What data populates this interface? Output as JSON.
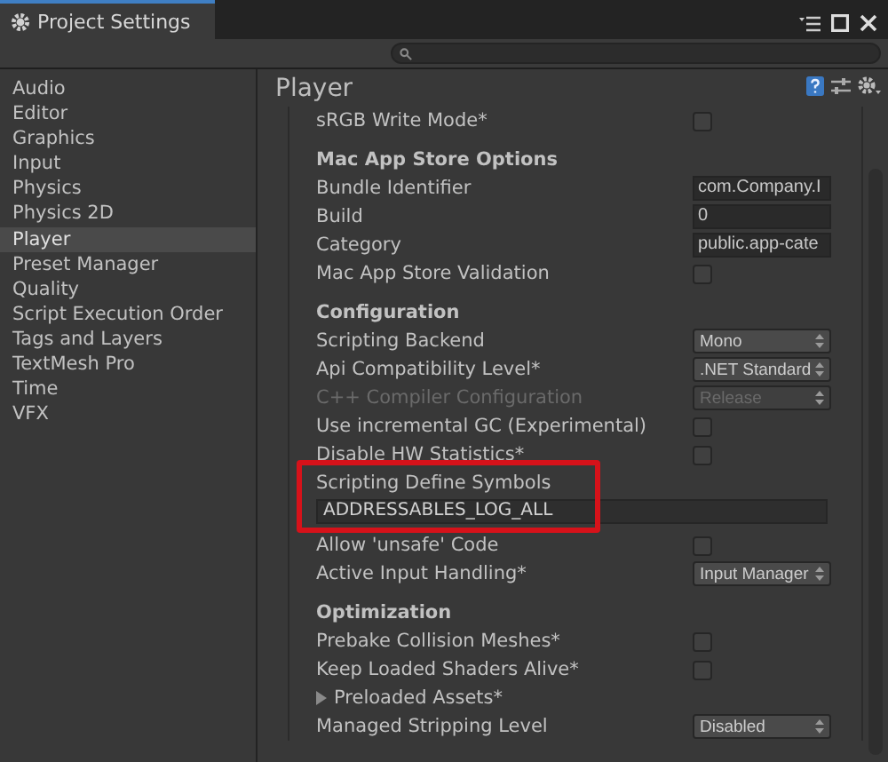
{
  "window": {
    "title": "Project Settings"
  },
  "sidebar": {
    "items": [
      {
        "label": "Audio",
        "selected": false
      },
      {
        "label": "Editor",
        "selected": false
      },
      {
        "label": "Graphics",
        "selected": false
      },
      {
        "label": "Input",
        "selected": false
      },
      {
        "label": "Physics",
        "selected": false
      },
      {
        "label": "Physics 2D",
        "selected": false
      },
      {
        "label": "Player",
        "selected": true
      },
      {
        "label": "Preset Manager",
        "selected": false
      },
      {
        "label": "Quality",
        "selected": false
      },
      {
        "label": "Script Execution Order",
        "selected": false
      },
      {
        "label": "Tags and Layers",
        "selected": false
      },
      {
        "label": "TextMesh Pro",
        "selected": false
      },
      {
        "label": "Time",
        "selected": false
      },
      {
        "label": "VFX",
        "selected": false
      }
    ]
  },
  "panel": {
    "title": "Player",
    "rows": [
      {
        "kind": "checkbox",
        "label": "sRGB Write Mode*",
        "checked": false,
        "disabled": false
      },
      {
        "kind": "header",
        "label": "Mac App Store Options"
      },
      {
        "kind": "text",
        "label": "Bundle Identifier",
        "value": "com.Company.I"
      },
      {
        "kind": "text",
        "label": "Build",
        "value": "0"
      },
      {
        "kind": "text",
        "label": "Category",
        "value": "public.app-cate"
      },
      {
        "kind": "checkbox",
        "label": "Mac App Store Validation",
        "checked": false,
        "disabled": false
      },
      {
        "kind": "header",
        "label": "Configuration"
      },
      {
        "kind": "dropdown",
        "label": "Scripting Backend",
        "value": "Mono",
        "disabled": false
      },
      {
        "kind": "dropdown",
        "label": "Api Compatibility Level*",
        "value": ".NET Standard",
        "disabled": false
      },
      {
        "kind": "dropdown",
        "label": "C++ Compiler Configuration",
        "value": "Release",
        "disabled": true
      },
      {
        "kind": "checkbox",
        "label": "Use incremental GC (Experimental)",
        "checked": false,
        "disabled": false
      },
      {
        "kind": "checkbox",
        "label": "Disable HW Statistics*",
        "checked": false,
        "disabled": false
      },
      {
        "kind": "symbols",
        "label": "Scripting Define Symbols",
        "value": "ADDRESSABLES_LOG_ALL",
        "highlighted": true
      },
      {
        "kind": "checkbox",
        "label": "Allow 'unsafe' Code",
        "checked": false,
        "disabled": false
      },
      {
        "kind": "dropdown",
        "label": "Active Input Handling*",
        "value": "Input Manager",
        "disabled": false
      },
      {
        "kind": "header",
        "label": "Optimization"
      },
      {
        "kind": "checkbox",
        "label": "Prebake Collision Meshes*",
        "checked": false,
        "disabled": false
      },
      {
        "kind": "checkbox",
        "label": "Keep Loaded Shaders Alive*",
        "checked": false,
        "disabled": false
      },
      {
        "kind": "foldout",
        "label": "Preloaded Assets*",
        "expanded": false
      },
      {
        "kind": "dropdown",
        "label": "Managed Stripping Level",
        "value": "Disabled",
        "disabled": false
      }
    ]
  }
}
